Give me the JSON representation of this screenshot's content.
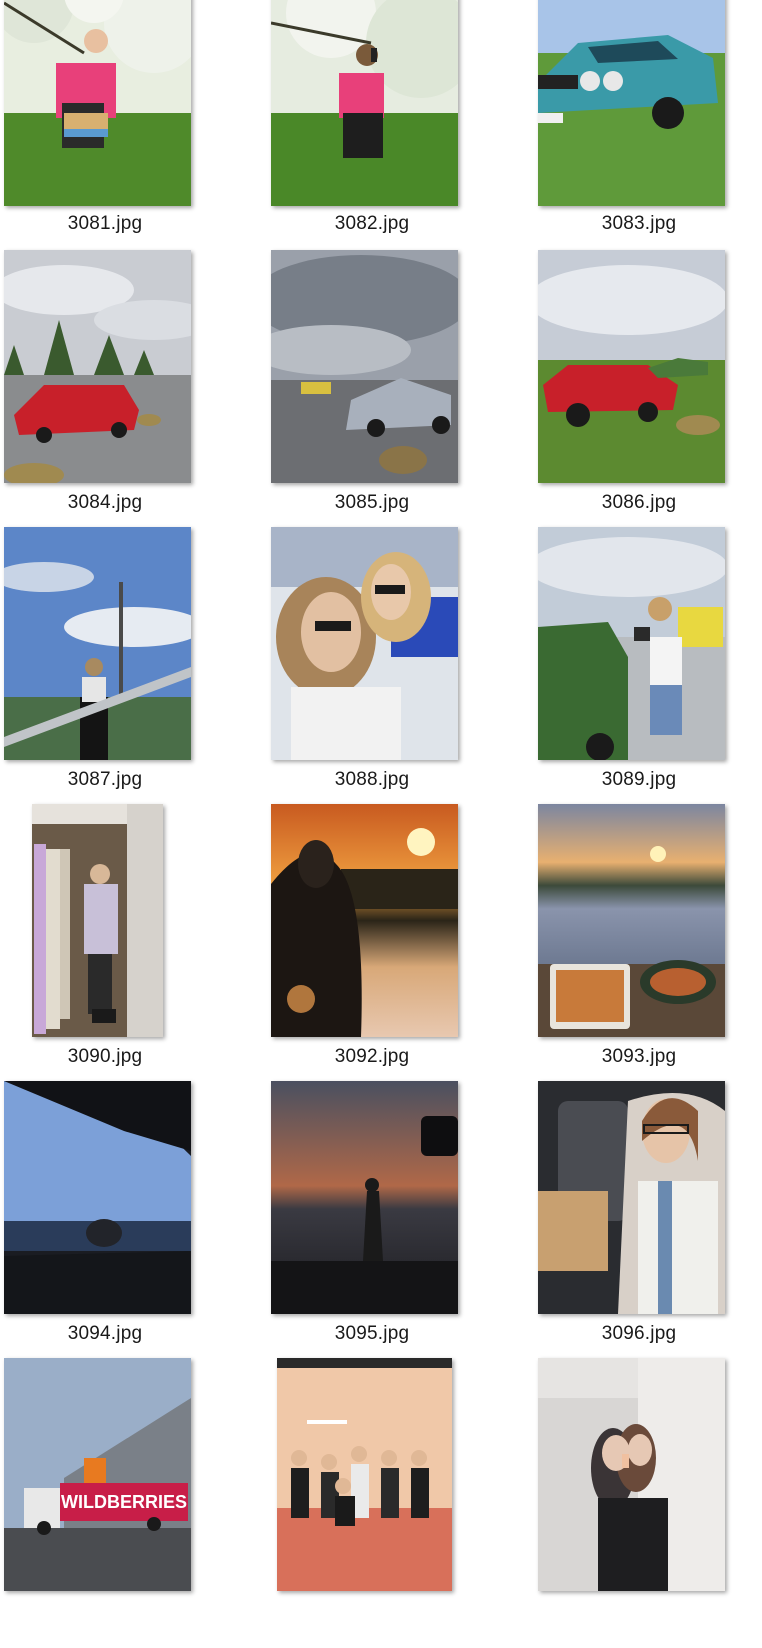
{
  "files": [
    {
      "name": "3081.jpg",
      "scene": "woman-in-pink-orchard"
    },
    {
      "name": "3082.jpg",
      "scene": "woman-photographing-orchard"
    },
    {
      "name": "3083.jpg",
      "scene": "teal-classic-car"
    },
    {
      "name": "3084.jpg",
      "scene": "red-convertible-track"
    },
    {
      "name": "3085.jpg",
      "scene": "cars-cloudy-sky"
    },
    {
      "name": "3086.jpg",
      "scene": "red-mustang-grass"
    },
    {
      "name": "3087.jpg",
      "scene": "woman-at-stadium-railing"
    },
    {
      "name": "3088.jpg",
      "scene": "two-women-selfie"
    },
    {
      "name": "3089.jpg",
      "scene": "woman-photographing-cars"
    },
    {
      "name": "3090.jpg",
      "scene": "closet-mirror-selfie"
    },
    {
      "name": "3092.jpg",
      "scene": "sunset-silhouette"
    },
    {
      "name": "3093.jpg",
      "scene": "sunset-picnic-food"
    },
    {
      "name": "3094.jpg",
      "scene": "car-window-sea"
    },
    {
      "name": "3095.jpg",
      "scene": "dusk-silhouette-car"
    },
    {
      "name": "3096.jpg",
      "scene": "woman-in-car-glasses"
    },
    {
      "name": "",
      "scene": "wildberries-truck"
    },
    {
      "name": "",
      "scene": "group-in-gym"
    },
    {
      "name": "",
      "scene": "bathroom-mirror-selfie"
    }
  ],
  "texts": {
    "truck_logo": "WILDBERRIES"
  },
  "colors": {
    "background": "#ffffff",
    "caption": "#1a1a1a"
  }
}
